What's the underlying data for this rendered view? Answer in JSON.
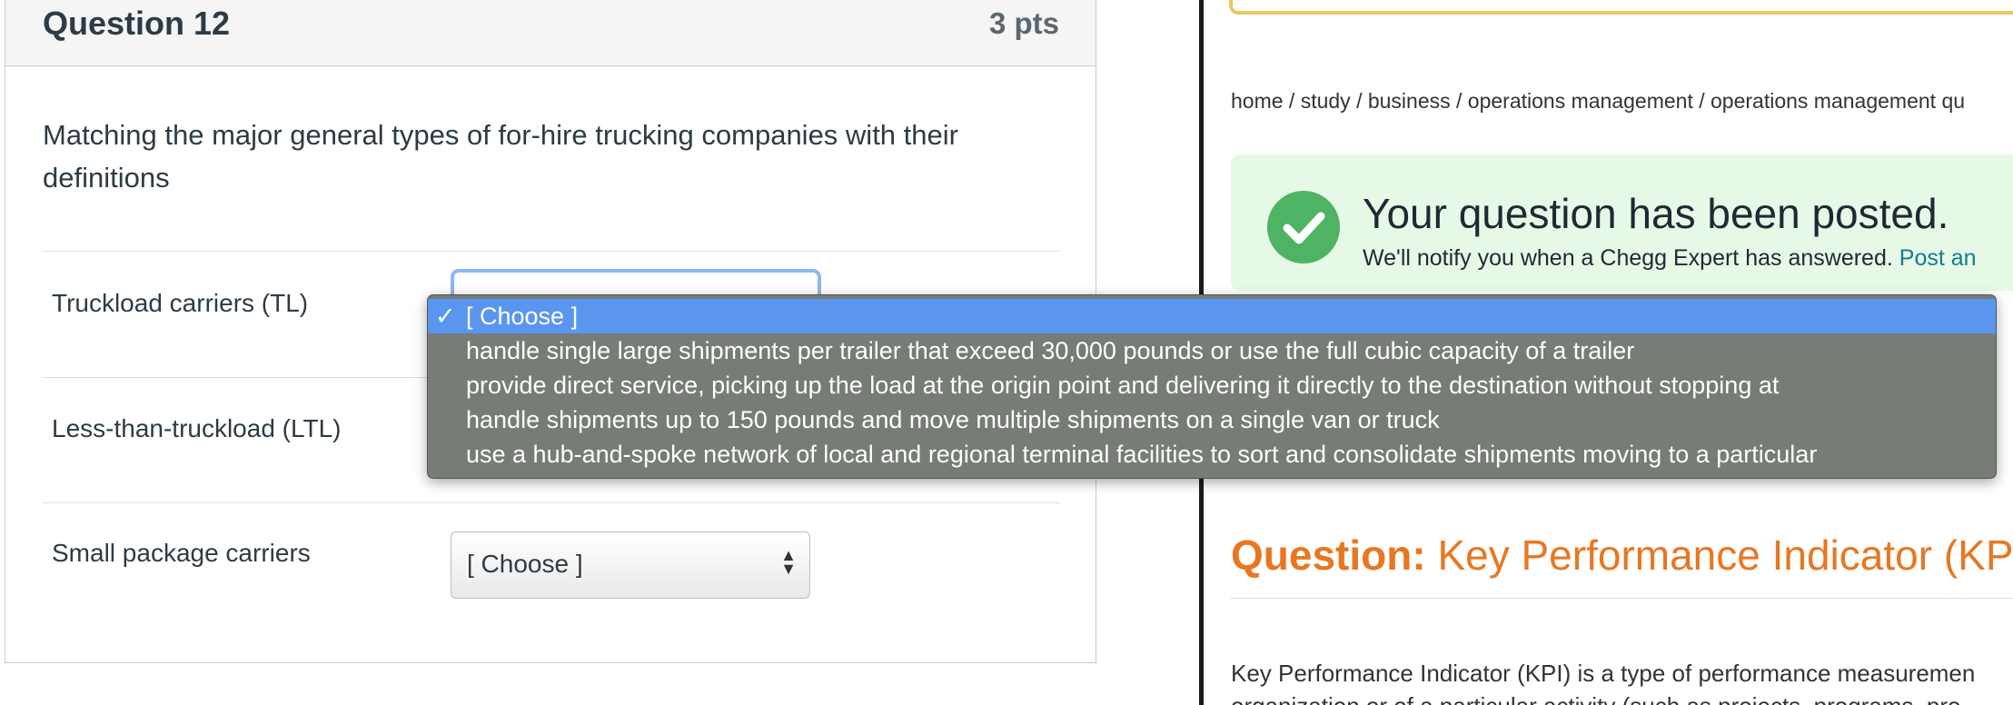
{
  "quiz": {
    "title": "Question 12",
    "points": "3 pts",
    "question_text": "Matching the major general types of for-hire trucking companies with their definitions",
    "rows": [
      {
        "label": "Truckload carriers (TL)",
        "selected": ""
      },
      {
        "label": "Less-than-truckload (LTL)",
        "selected": ""
      },
      {
        "label": "Small package carriers",
        "selected": "[ Choose ]"
      }
    ]
  },
  "dropdown": {
    "checkmark": "✓",
    "options": [
      "[ Choose ]",
      "handle single large shipments per trailer that exceed 30,000 pounds or use the full cubic capacity of a trailer",
      "provide direct service, picking up the load at the origin point and delivering it directly to the destination without stopping at",
      "handle shipments up to 150 pounds and move multiple shipments on a single van or truck",
      "use a hub-and-spoke network of local and regional terminal facilities to sort and consolidate shipments moving to a particular"
    ],
    "selected_index": 0
  },
  "right_page": {
    "breadcrumb": "home / study / business / operations management / operations management qu",
    "posted_title": "Your question has been posted.",
    "posted_subtitle": "We'll notify you when a Chegg Expert has answered.",
    "posted_link": "Post an",
    "question_label": "Question:",
    "question_title": "Key Performance Indicator (KP",
    "body_line1": "Key Performance Indicator (KPI) is a type of performance measuremen",
    "body_line2": "organization or of a particular activity (such as projects, programs, pro"
  },
  "colors": {
    "accent_orange": "#e87722",
    "success_green": "#4fb364",
    "menu_highlight": "#5a96f0",
    "menu_background": "#767c76"
  },
  "icons": {
    "success": "check-circle-icon",
    "select_arrows": "up-down-arrows-icon"
  }
}
